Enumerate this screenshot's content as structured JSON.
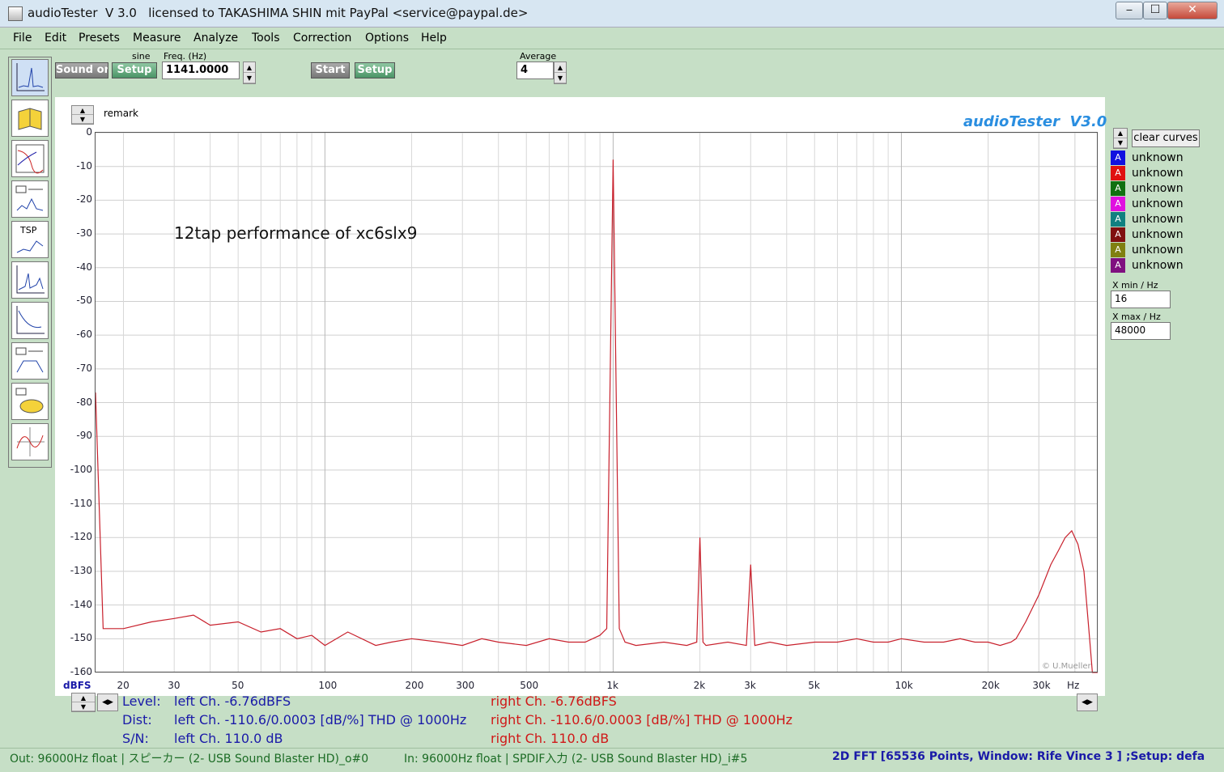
{
  "window": {
    "title": "audioTester  V 3.0   licensed to TAKASHIMA SHIN mit PayPal <service@paypal.de>",
    "controls": [
      "⎯",
      "☐",
      "✕"
    ]
  },
  "menu": [
    "File",
    "Edit",
    "Presets",
    "Measure",
    "Analyze",
    "Tools",
    "Correction",
    "Options",
    "Help"
  ],
  "toolbar": {
    "sound_label": "Sound or",
    "signal_type": "sine",
    "setup_label": "Setup",
    "freq_label": "Freq. (Hz)",
    "freq_value": "1141.0000",
    "start_label": "Start",
    "setup2_label": "Setup",
    "average_label": "Average",
    "average_value": "4"
  },
  "sidebar": {
    "tsp_label": "TSP"
  },
  "plot": {
    "remark_label": "remark",
    "brand": "audioTester  V3.0",
    "annotation": "12tap performance of xc6slx9",
    "watermark": "© U.Mueller",
    "y_unit": "dBFS",
    "x_unit": "Hz"
  },
  "chart_data": {
    "type": "line",
    "ylim": [
      -160,
      0
    ],
    "xlim": [
      16,
      48000
    ],
    "xscale": "log",
    "yticks": [
      "0",
      "-10",
      "-20",
      "-30",
      "-40",
      "-50",
      "-60",
      "-70",
      "-80",
      "-90",
      "-100",
      "-110",
      "-120",
      "-130",
      "-140",
      "-150",
      "-160"
    ],
    "xticks": [
      {
        "v": 20,
        "l": "20"
      },
      {
        "v": 30,
        "l": "30"
      },
      {
        "v": 50,
        "l": "50"
      },
      {
        "v": 100,
        "l": "100"
      },
      {
        "v": 200,
        "l": "200"
      },
      {
        "v": 300,
        "l": "300"
      },
      {
        "v": 500,
        "l": "500"
      },
      {
        "v": 1000,
        "l": "1k"
      },
      {
        "v": 2000,
        "l": "2k"
      },
      {
        "v": 3000,
        "l": "3k"
      },
      {
        "v": 5000,
        "l": "5k"
      },
      {
        "v": 10000,
        "l": "10k"
      },
      {
        "v": 20000,
        "l": "20k"
      },
      {
        "v": 30000,
        "l": "30k"
      }
    ],
    "grid": true,
    "series": [
      {
        "color": "#c8202c",
        "x": [
          16,
          17,
          20,
          25,
          30,
          35,
          40,
          50,
          60,
          70,
          80,
          90,
          100,
          120,
          150,
          170,
          200,
          250,
          300,
          350,
          400,
          500,
          600,
          700,
          800,
          900,
          950,
          1000,
          1050,
          1100,
          1200,
          1500,
          1800,
          1950,
          2000,
          2050,
          2100,
          2500,
          2900,
          3000,
          3100,
          3500,
          4000,
          5000,
          6000,
          7000,
          8000,
          9000,
          10000,
          12000,
          14000,
          16000,
          18000,
          20000,
          22000,
          24000,
          25000,
          27000,
          30000,
          33000,
          35000,
          37000,
          39000,
          41000,
          43000,
          44000,
          45000,
          46000,
          47000,
          48000
        ],
        "y": [
          -77,
          -147,
          -147,
          -145,
          -144,
          -143,
          -146,
          -145,
          -148,
          -147,
          -150,
          -149,
          -152,
          -148,
          -152,
          -151,
          -150,
          -151,
          -152,
          -150,
          -151,
          -152,
          -150,
          -151,
          -151,
          -149,
          -147,
          -8,
          -147,
          -151,
          -152,
          -151,
          -152,
          -151,
          -120,
          -151,
          -152,
          -151,
          -152,
          -128,
          -152,
          -151,
          -152,
          -151,
          -151,
          -150,
          -151,
          -151,
          -150,
          -151,
          -151,
          -150,
          -151,
          -151,
          -152,
          -151,
          -150,
          -145,
          -137,
          -128,
          -124,
          -120,
          -118,
          -122,
          -130,
          -140,
          -150,
          -160,
          -160,
          -160
        ]
      }
    ]
  },
  "legend": {
    "clear_label": "clear curves",
    "entries": [
      {
        "label": "unknown",
        "color": "#1010e0"
      },
      {
        "label": "unknown",
        "color": "#e01010"
      },
      {
        "label": "unknown",
        "color": "#107010"
      },
      {
        "label": "unknown",
        "color": "#e010e0"
      },
      {
        "label": "unknown",
        "color": "#108080"
      },
      {
        "label": "unknown",
        "color": "#801010"
      },
      {
        "label": "unknown",
        "color": "#808010"
      },
      {
        "label": "unknown",
        "color": "#801080"
      }
    ],
    "swatch_letter": "A",
    "xmin_label": "X min / Hz",
    "xmin_value": "16",
    "xmax_label": "X max / Hz",
    "xmax_value": "48000"
  },
  "readouts": {
    "level_label": "Level:",
    "dist_label": "Dist:",
    "sn_label": "S/N:",
    "left_level": "left Ch. -6.76dBFS",
    "left_dist": "left Ch. -110.6/0.0003 [dB/%] THD @ 1000Hz",
    "left_sn": "left Ch. 110.0 dB",
    "right_level": "right Ch. -6.76dBFS",
    "right_dist": "right Ch. -110.6/0.0003 [dB/%] THD @ 1000Hz",
    "right_sn": "right Ch. 110.0 dB"
  },
  "status": {
    "out": "Out: 96000Hz float   | スピーカー (2- USB Sound Blaster HD)_o#0",
    "in": "In: 96000Hz float   | SPDIF入力 (2- USB Sound Blaster HD)_i#5",
    "fft": "2D FFT [65536 Points, Window: Rife Vince 3 ]  ;Setup:  defa"
  }
}
